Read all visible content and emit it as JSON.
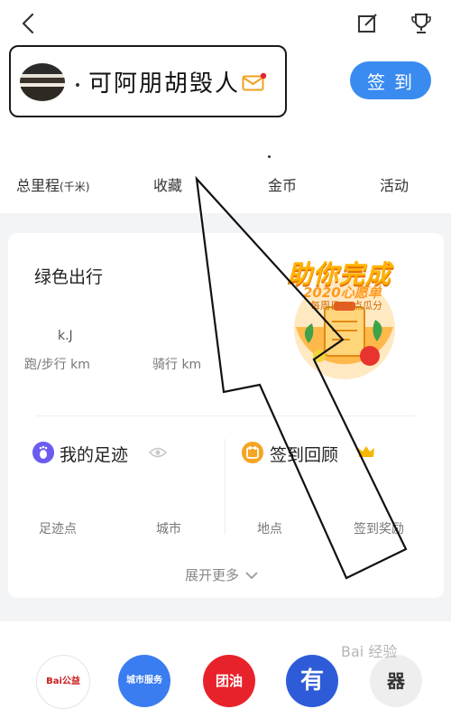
{
  "nav": {
    "back_icon": "chevron-left-icon",
    "edit_icon": "edit-icon",
    "trophy_icon": "trophy-icon"
  },
  "profile": {
    "username": "可阿朋胡毁人",
    "mail_icon": "mail-icon",
    "checkin_label": "签到"
  },
  "stats": [
    {
      "label": "总里程",
      "unit": "(千米)"
    },
    {
      "label": "收藏",
      "unit": ""
    },
    {
      "label": "金币",
      "unit": ""
    },
    {
      "label": "活动",
      "unit": ""
    }
  ],
  "green_travel": {
    "title": "绿色出行",
    "value": "k.J",
    "run_label": "跑/步行 km",
    "ride_label": "骑行 km"
  },
  "promo": {
    "title": "助你完成",
    "subtitle": "2020心愿单",
    "note": "每周日24点瓜分"
  },
  "footprint": {
    "title": "我的足迹",
    "icon": "footprint-icon",
    "eye_icon": "eye-icon"
  },
  "checkin_review": {
    "title": "签到回顾",
    "icon": "calendar-icon",
    "crown_icon": "crown-icon"
  },
  "sub_labels": [
    "足迹点",
    "城市",
    "地点",
    "签到奖励"
  ],
  "expand_label": "展开更多",
  "services": [
    {
      "label": "Bai公益"
    },
    {
      "label": "城市服务"
    },
    {
      "label": "团油"
    },
    {
      "label": "有"
    },
    {
      "label": "器"
    }
  ],
  "watermark": "Bai 经验",
  "colors": {
    "accent": "#3a8bf0",
    "promo": "#ffb300",
    "text": "#222222"
  }
}
